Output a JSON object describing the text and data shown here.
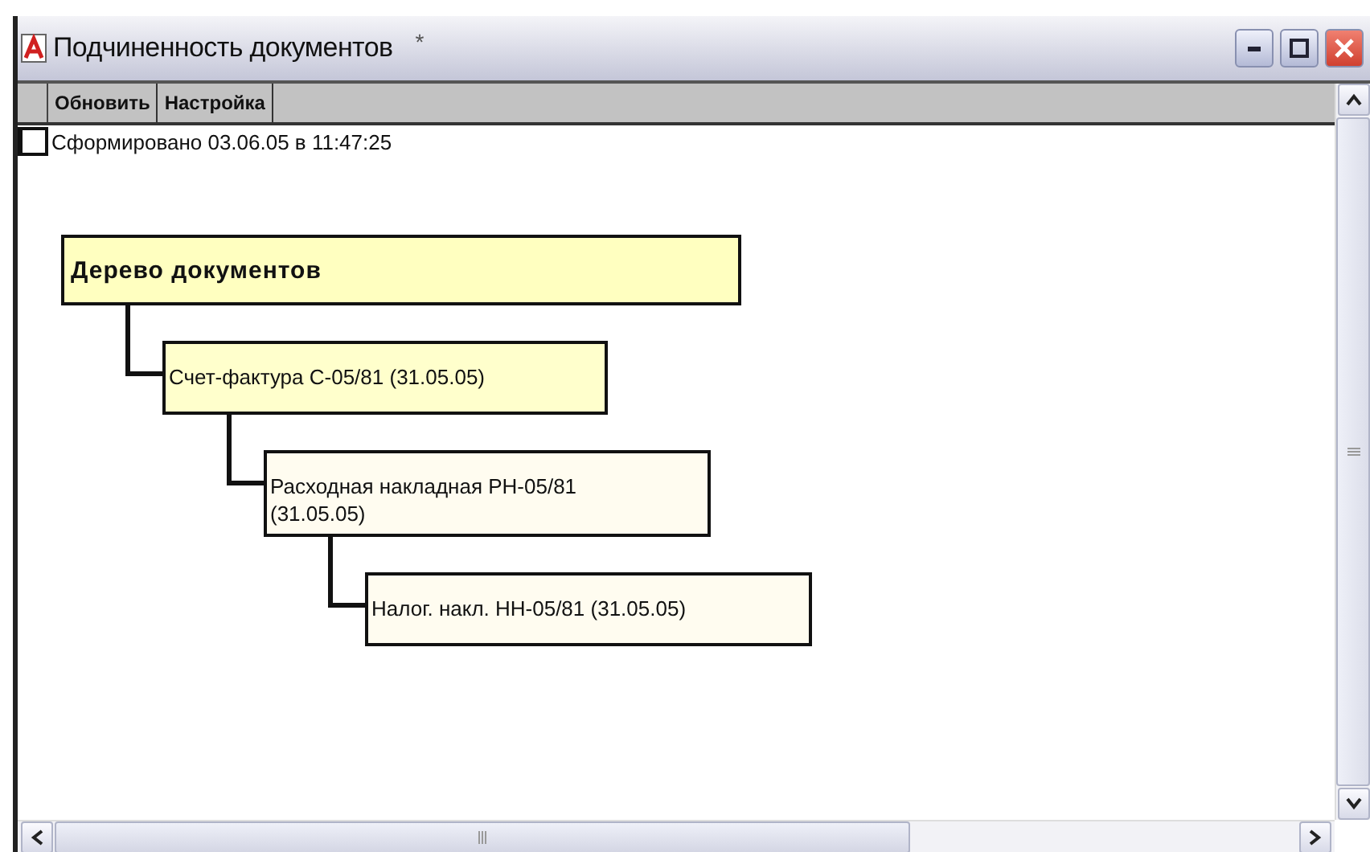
{
  "window": {
    "title": "Подчиненность документов",
    "modified_mark": "*"
  },
  "toolbar": {
    "buttons": [
      "Обновить",
      "Настройка"
    ]
  },
  "status_line": "Сформировано 03.06.05 в 11:47:25",
  "tree": {
    "label": "Дерево документов",
    "children": [
      {
        "label": "Счет-фактура С-05/81 (31.05.05)",
        "children": [
          {
            "label": "Расходная накладная РН-05/81 (31.05.05)",
            "children": [
              {
                "label": "Налог. накл. НН-05/81 (31.05.05)"
              }
            ]
          }
        ]
      }
    ]
  }
}
